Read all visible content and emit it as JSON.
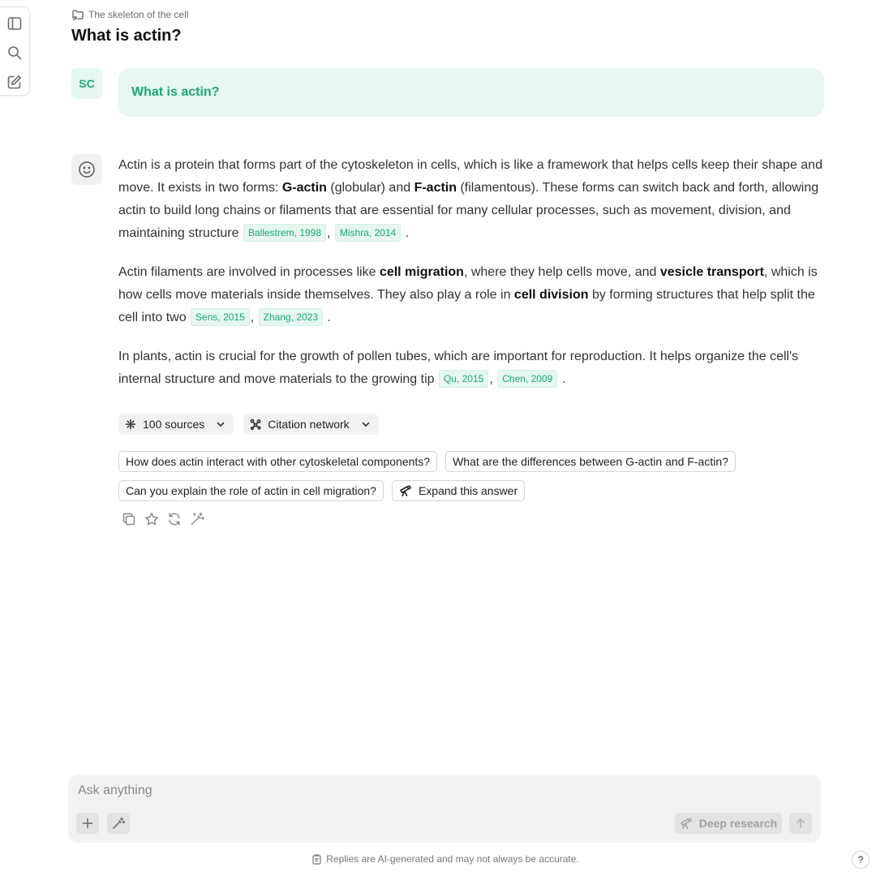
{
  "header": {
    "breadcrumb": "The skeleton of the cell",
    "title": "What is actin?"
  },
  "user_message": {
    "avatar": "SC",
    "text": "What is actin?"
  },
  "answer": {
    "p1": {
      "t1": "Actin is a protein that forms part of the cytoskeleton in cells, which is like a framework that helps cells keep their shape and move. It exists in two forms: ",
      "b1": "G-actin",
      "t2": " (globular) and ",
      "b2": "F-actin",
      "t3": " (filamentous). These forms can switch back and forth, allowing actin to build long chains or filaments that are essential for many cellular processes, such as movement, division, and maintaining structure ",
      "c1": "Ballestrem, 1998",
      "sep": ",",
      "c2": "Mishra, 2014",
      "end": "."
    },
    "p2": {
      "t1": "Actin filaments are involved in processes like ",
      "b1": "cell migration",
      "t2": ", where they help cells move, and ",
      "b2": "vesicle transport",
      "t3": ", which is how cells move materials inside themselves. They also play a role in ",
      "b3": "cell division",
      "t4": " by forming structures that help split the cell into two ",
      "c1": "Sens, 2015",
      "sep": ",",
      "c2": "Zhang, 2023",
      "end": "."
    },
    "p3": {
      "t1": "In plants, actin is crucial for the growth of pollen tubes, which are important for reproduction. It helps organize the cell's internal structure and move materials to the growing tip ",
      "c1": "Qu, 2015",
      "sep": ",",
      "c2": "Chen, 2009",
      "end": "."
    }
  },
  "sources": {
    "sources_label": "100 sources",
    "network_label": "Citation network"
  },
  "followups": [
    "How does actin interact with other cytoskeletal components?",
    "What are the differences between G-actin and F-actin?",
    "Can you explain the role of actin in cell migration?"
  ],
  "expand_label": "Expand this answer",
  "composer": {
    "placeholder": "Ask anything",
    "deep_research_label": "Deep research"
  },
  "disclaimer": "Replies are AI-generated and may not always be accurate.",
  "help_label": "?",
  "icons": {
    "rail": [
      "sidebar-toggle-icon",
      "search-icon",
      "new-chat-icon"
    ],
    "actions": [
      "copy-icon",
      "star-icon",
      "refresh-icon",
      "magic-wand-icon"
    ]
  },
  "colors": {
    "accent": "#1aa870",
    "accent_bg": "#e8f7f0"
  }
}
